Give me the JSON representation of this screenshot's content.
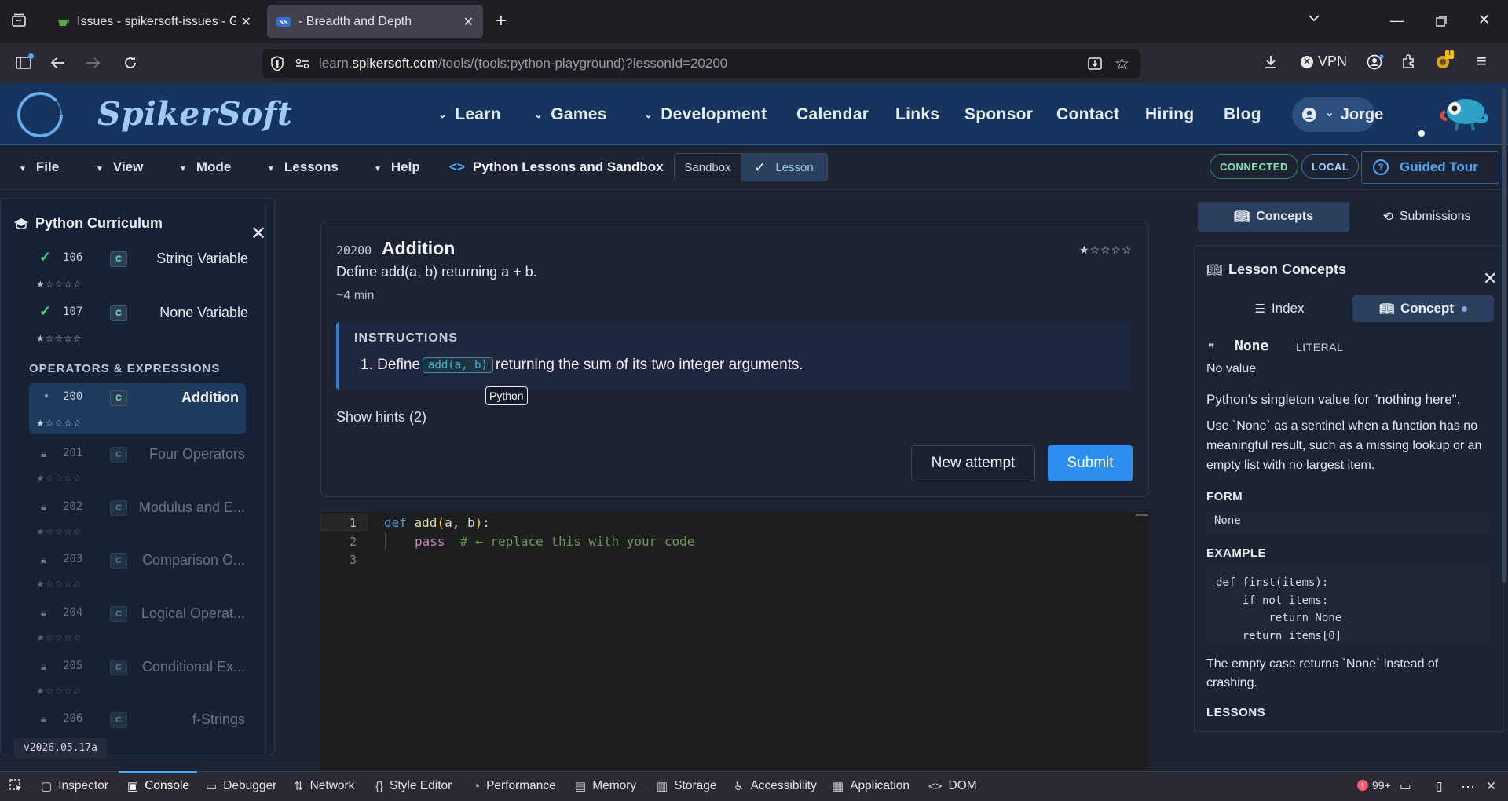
{
  "browser": {
    "tabs": [
      {
        "title": "Issues - spikersoft-issues - Gitea",
        "active": false
      },
      {
        "title": "- Breadth and Depth",
        "active": true
      }
    ],
    "url_prefix": "learn.",
    "url_domain": "spikersoft.com",
    "url_rest": "/tools/(tools:python-playground)?lessonId=20200",
    "vpn_label": "VPN",
    "extension_badge": "!"
  },
  "site": {
    "brand": "SpikerSoft",
    "nav": [
      {
        "label": "Learn",
        "dropdown": true
      },
      {
        "label": "Games",
        "dropdown": true
      },
      {
        "label": "Development",
        "dropdown": true
      },
      {
        "label": "Calendar",
        "dropdown": false
      },
      {
        "label": "Links",
        "dropdown": false
      },
      {
        "label": "Sponsor",
        "dropdown": false
      },
      {
        "label": "Contact",
        "dropdown": false
      },
      {
        "label": "Hiring",
        "dropdown": false
      },
      {
        "label": "Blog",
        "dropdown": false
      }
    ],
    "user": "Jorge"
  },
  "menubar": {
    "items": [
      "File",
      "View",
      "Mode",
      "Lessons",
      "Help"
    ],
    "title": "Python Lessons and Sandbox",
    "toggle": {
      "sandbox": "Sandbox",
      "lesson": "Lesson",
      "selected": "Lesson"
    },
    "status_connected": "CONNECTED",
    "status_local": "LOCAL",
    "guided_tour": "Guided Tour"
  },
  "sidebar": {
    "title": "Python Curriculum",
    "section": "OPERATORS & EXPRESSIONS",
    "star_text": "★☆☆☆☆",
    "items": [
      {
        "num": "106",
        "title": "String Variable",
        "state": "done"
      },
      {
        "num": "107",
        "title": "None Variable",
        "state": "done"
      },
      {
        "num": "200",
        "title": "Addition",
        "state": "active"
      },
      {
        "num": "201",
        "title": "Four Operators",
        "state": "locked"
      },
      {
        "num": "202",
        "title": "Modulus and E...",
        "state": "locked"
      },
      {
        "num": "203",
        "title": "Comparison O...",
        "state": "locked"
      },
      {
        "num": "204",
        "title": "Logical Operat...",
        "state": "locked"
      },
      {
        "num": "205",
        "title": "Conditional Ex...",
        "state": "locked"
      },
      {
        "num": "206",
        "title": "f-Strings",
        "state": "locked"
      }
    ],
    "badge_letter": "C",
    "version": "v2026.05.17a"
  },
  "lesson": {
    "id": "20200",
    "title": "Addition",
    "summary": "Define add(a, b) returning a + b.",
    "duration": "~4 min",
    "rating": "★☆☆☆☆",
    "instructions_label": "INSTRUCTIONS",
    "instruction_prefix": "1. Define",
    "instruction_code": "add(a, b)",
    "instruction_suffix": "returning the sum of its two integer arguments.",
    "tooltip": "Python",
    "hints_label": "Show hints (2)",
    "new_attempt_label": "New attempt",
    "submit_label": "Submit"
  },
  "editor": {
    "line_numbers": [
      "1",
      "2",
      "3"
    ],
    "line1_kw": "def",
    "line1_fn": "add",
    "line1_lparen": "(",
    "line1_args": "a, b",
    "line1_rparen": ")",
    "line1_colon": ":",
    "line2_kw": "pass",
    "line2_comment": "# ← replace this with your code"
  },
  "concepts_panel": {
    "tab_concepts": "Concepts",
    "tab_submissions": "Submissions",
    "title": "Lesson Concepts",
    "tab_index": "Index",
    "tab_concept": "Concept",
    "concept_name": "None",
    "concept_kind": "LITERAL",
    "concept_short": "No value",
    "description": "Python's singleton value for \"nothing here\".",
    "usage": "Use `None` as a sentinel when a function has no meaningful result, such as a missing lookup or an empty list with no largest item.",
    "form_label": "FORM",
    "form_code": "None",
    "example_label": "EXAMPLE",
    "example_code": "def first(items):\n    if not items:\n        return None\n    return items[0]",
    "example_note": "The empty case returns `None` instead of crashing.",
    "lessons_label": "LESSONS"
  },
  "devtools": {
    "tabs": [
      "Inspector",
      "Console",
      "Debugger",
      "Network",
      "Style Editor",
      "Performance",
      "Memory",
      "Storage",
      "Accessibility",
      "Application",
      "DOM"
    ],
    "active": "Console",
    "error_count": "99+"
  },
  "colors": {
    "accent": "#2e8ef0",
    "header_bg": "#16355e",
    "page_bg": "#1c2333",
    "success": "#3ddc84"
  }
}
